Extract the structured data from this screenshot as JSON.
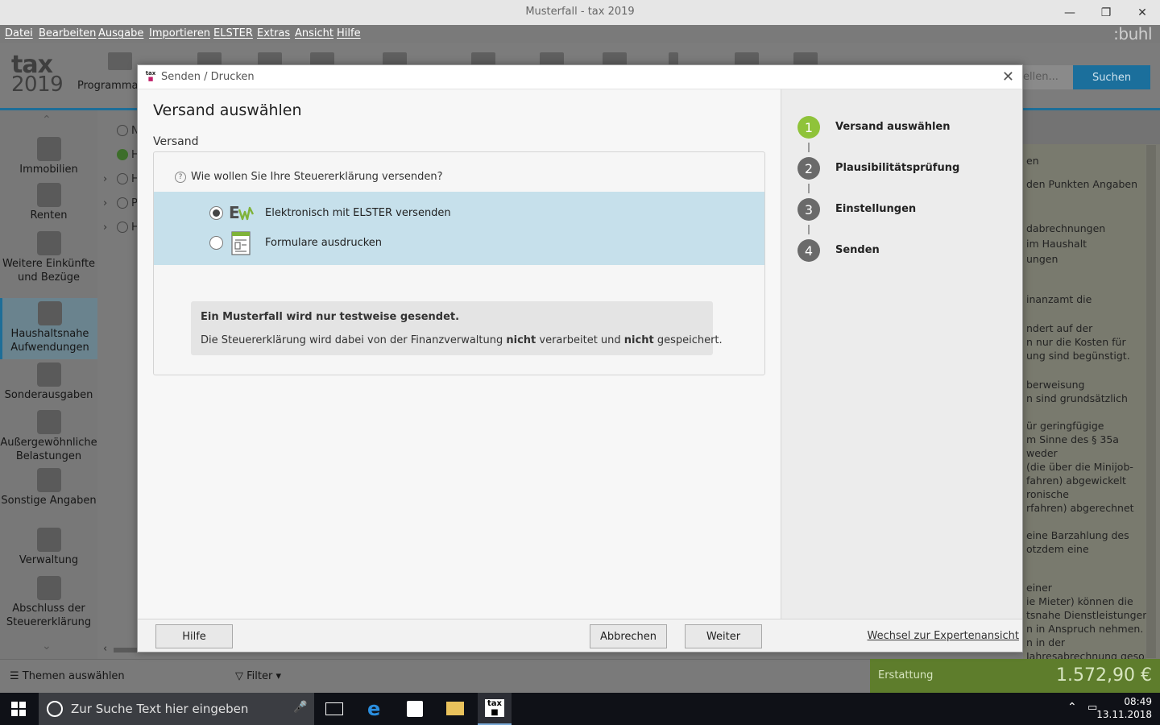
{
  "window": {
    "title": "Musterfall - tax 2019"
  },
  "menu": {
    "items": [
      "Datei",
      "Bearbeiten",
      "Ausgabe",
      "Importieren",
      "ELSTER",
      "Extras",
      "Ansicht",
      "Hilfe"
    ],
    "brand": ":buhl"
  },
  "toolbar": {
    "logo_line1": "tax",
    "logo_line2": "2019",
    "program_label": "Programmau",
    "search_placeholder": "ellen...",
    "search_button": "Suchen"
  },
  "sidebar": {
    "items": [
      {
        "label": "Immobilien",
        "icon": "house-icon"
      },
      {
        "label": "Renten",
        "icon": "person-icon"
      },
      {
        "label": "Weitere Einkünfte und Bezüge",
        "icon": "coins-hand-icon"
      },
      {
        "label": "Haushaltsnahe Aufwendungen",
        "icon": "household-icon"
      },
      {
        "label": "Sonderausgaben",
        "icon": "church-icon"
      },
      {
        "label": "Außergewöhnliche Belastungen",
        "icon": "first-aid-icon"
      },
      {
        "label": "Sonstige Angaben",
        "icon": "documents-icon"
      },
      {
        "label": "Verwaltung",
        "icon": "car-icon"
      },
      {
        "label": "Abschluss der Steuererklärung",
        "icon": "printer-icon"
      }
    ]
  },
  "middle": {
    "row_letters": [
      "N",
      "H",
      "H",
      "P",
      "H"
    ]
  },
  "right_pane": {
    "lines": [
      "en",
      "den Punkten Angaben",
      "dabrechnungen",
      "im Haushalt",
      "ungen",
      "inanzamt die",
      "ndert auf der",
      "n nur die Kosten für",
      "ung sind begünstigt.",
      "berweisung",
      "n sind grundsätzlich",
      "ür geringfügige",
      "m Sinne des § 35a",
      "weder",
      "(die über die Minijob-",
      "fahren) abgewickelt",
      "ronische",
      "rfahren) abgerechnet",
      "eine Barzahlung des",
      "otzdem eine",
      "einer",
      "ie Mieter) können die",
      "tsnahe Dienstleistungen",
      "n in Anspruch nehmen.",
      "n in der",
      "Jahresabrechnung gesondert aufgeführt sein - einzeln"
    ]
  },
  "bottom": {
    "themen": "Themen auswählen",
    "filter": "Filter",
    "refund_label": "Erstattung",
    "refund_amount": "1.572,90 €"
  },
  "taskbar": {
    "search_placeholder": "Zur Suche Text hier eingeben",
    "time": "08:49",
    "date": "13.11.2018"
  },
  "dialog": {
    "title": "Senden / Drucken",
    "heading": "Versand auswählen",
    "section": "Versand",
    "question": "Wie wollen Sie Ihre Steuererklärung versenden?",
    "options": [
      {
        "label": "Elektronisch mit ELSTER versenden",
        "selected": true,
        "icon": "elster-icon"
      },
      {
        "label": "Formulare ausdrucken",
        "selected": false,
        "icon": "print-form-icon"
      }
    ],
    "notice_title": "Ein Musterfall wird nur testweise gesendet.",
    "notice_text_1": "Die Steuererklärung wird dabei von der Finanzverwaltung ",
    "notice_bold_1": "nicht",
    "notice_text_2": " verarbeitet und ",
    "notice_bold_2": "nicht",
    "notice_text_3": " gespeichert.",
    "steps": [
      {
        "num": "1",
        "label": "Versand auswählen",
        "active": true
      },
      {
        "num": "2",
        "label": "Plausibilitätsprüfung",
        "active": false
      },
      {
        "num": "3",
        "label": "Einstellungen",
        "active": false
      },
      {
        "num": "4",
        "label": "Senden",
        "active": false
      }
    ],
    "buttons": {
      "help": "Hilfe",
      "cancel": "Abbrechen",
      "next": "Weiter"
    },
    "expert_link": "Wechsel zur Expertenansicht"
  },
  "colors": {
    "accent": "#1d6e98",
    "step_active": "#8fc33a",
    "option_band": "#c6e0eb",
    "refund": "#5e7d2c"
  }
}
